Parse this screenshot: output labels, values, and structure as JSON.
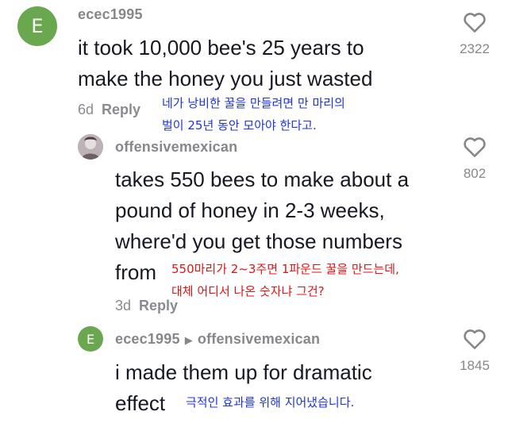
{
  "comments": [
    {
      "avatar_letter": "E",
      "username": "ecec1995",
      "text_lines": [
        "it took 10,000 bee's 25 years to",
        "make the honey you just wasted"
      ],
      "age": "6d",
      "reply_label": "Reply",
      "likes": "2322",
      "translation_lines": [
        "네가 낭비한 꿀을 만들려면 만 마리의",
        "벌이 25년 동안 모아야 한다고."
      ]
    },
    {
      "username": "offensivemexican",
      "text_lines": [
        "takes 550 bees to make about a",
        "pound of honey in 2-3 weeks,",
        "where'd you get those numbers",
        "from"
      ],
      "age": "3d",
      "reply_label": "Reply",
      "likes": "802",
      "translation_lines": [
        "550마리가 2~3주면 1파운드 꿀을 만드는데,",
        "대체 어디서 나온 숫자냐 그건?"
      ]
    },
    {
      "avatar_letter": "E",
      "username": "ecec1995",
      "reply_to": "offensivemexican",
      "text_lines": [
        "i made them up for dramatic",
        "effect"
      ],
      "likes": "1845",
      "translation_lines": [
        "극적인 효과를 위해 지어냈습니다."
      ]
    }
  ],
  "colors": {
    "annotation_blue": "#1f35d8",
    "annotation_red": "#e01515",
    "avatar_green": "#6aa84f",
    "muted_gray": "#86878b"
  }
}
